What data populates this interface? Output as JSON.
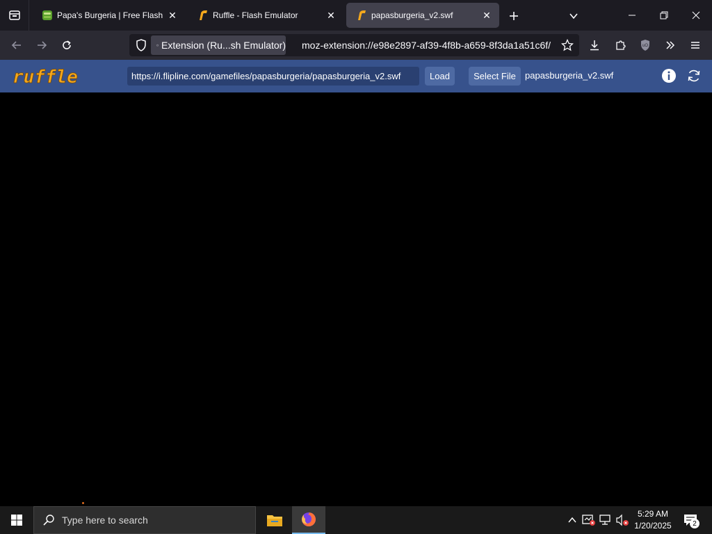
{
  "browser": {
    "tabs": [
      {
        "label": "Papa's Burgeria | Free Flash Gam",
        "favicon": "burgeria-favicon",
        "active": false
      },
      {
        "label": "Ruffle - Flash Emulator",
        "favicon": "ruffle-favicon",
        "active": false
      },
      {
        "label": "papasburgeria_v2.swf",
        "favicon": "ruffle-favicon",
        "active": true
      }
    ],
    "urlbar": {
      "extension_chip_label": "Extension (Ru...sh Emulator)",
      "url": "moz-extension://e98e2897-af39-4f8b-a659-8f3da1a51c6f/"
    }
  },
  "ruffle": {
    "logo_text": "ruffle",
    "swf_url": "https://i.flipline.com/gamefiles/papasburgeria/papasburgeria_v2.swf",
    "load_label": "Load",
    "select_file_label": "Select File",
    "file_name": "papasburgeria_v2.swf"
  },
  "taskbar": {
    "search_placeholder": "Type here to search",
    "time": "5:29 AM",
    "date": "1/20/2025",
    "notification_count": "2"
  },
  "colors": {
    "tabbar_bg": "#1c1b22",
    "navbar_bg": "#2b2a33",
    "ruffle_bar_bg": "#37528c",
    "ruffle_accent": "#f4a81d",
    "player_bg": "#000000"
  }
}
